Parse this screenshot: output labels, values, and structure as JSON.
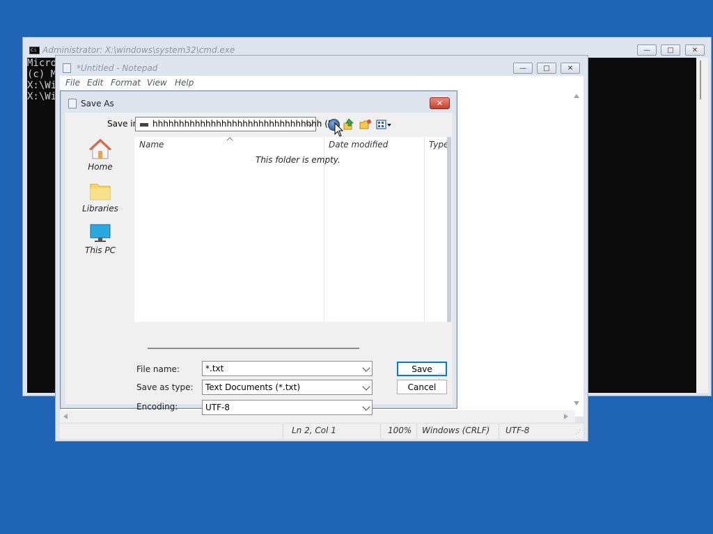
{
  "cmd": {
    "title": "Administrator: X:\\windows\\system32\\cmd.exe",
    "lines": [
      "Micro",
      "(c) M",
      "",
      "X:\\Wi",
      "",
      "X:\\Wi"
    ],
    "buttons": {
      "minimize": "—",
      "maximize": "□",
      "close": "✕"
    }
  },
  "notepad": {
    "title": "*Untitled - Notepad",
    "menu": [
      "File",
      "Edit",
      "Format",
      "View",
      "Help"
    ],
    "status": {
      "position": "Ln 2, Col 1",
      "zoom": "100%",
      "line_ending": "Windows (CRLF)",
      "encoding": "UTF-8"
    }
  },
  "dialog": {
    "title": "Save As",
    "close_label": "✕",
    "save_in_label": "Save in:",
    "save_in_value": "hhhhhhhhhhhhhhhhhhhhhhhhhhhhhhhh (E:)",
    "places": [
      {
        "label": "Home",
        "icon": "home-icon"
      },
      {
        "label": "Libraries",
        "icon": "libraries-folder-icon"
      },
      {
        "label": "This PC",
        "icon": "this-pc-monitor-icon"
      }
    ],
    "columns": [
      "Name",
      "Date modified",
      "Type"
    ],
    "empty_message": "This folder is empty.",
    "file_name_label": "File name:",
    "file_name_value": "*.txt",
    "save_as_type_label": "Save as type:",
    "save_as_type_value": "Text Documents (*.txt)",
    "encoding_label": "Encoding:",
    "encoding_value": "UTF-8",
    "save_button": "Save",
    "cancel_button": "Cancel"
  },
  "colors": {
    "desktop": "#1f64b4",
    "console_bg": "#0c0c0c",
    "default_button_border": "#0078d7",
    "close_button": "#c6402d"
  }
}
